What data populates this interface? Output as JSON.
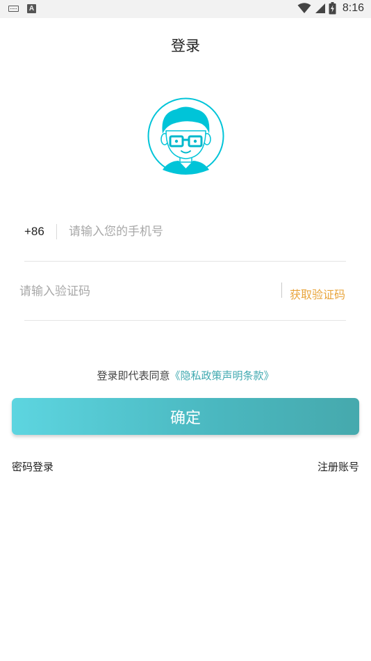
{
  "status_bar": {
    "time": "8:16",
    "icons": [
      "keyboard-icon",
      "a-letter-icon",
      "wifi-icon",
      "signal-icon",
      "battery-charging-icon"
    ],
    "a_icon_letter": "A"
  },
  "header": {
    "title": "登录"
  },
  "avatar": {
    "icon": "user-avatar-icon",
    "accent_color": "#00c4d8"
  },
  "phone": {
    "country_code": "+86",
    "placeholder": "请输入您的手机号",
    "value": ""
  },
  "verification": {
    "placeholder": "请输入验证码",
    "value": "",
    "get_code_label": "获取验证码"
  },
  "agreement": {
    "prefix": "登录即代表同意",
    "link_text": "《隐私政策声明条款》"
  },
  "confirm_label": "确定",
  "footer": {
    "password_login": "密码登录",
    "register": "注册账号"
  },
  "colors": {
    "accent": "#4ab7bf",
    "link": "#40a9b0",
    "code_button": "#e9a53c"
  }
}
